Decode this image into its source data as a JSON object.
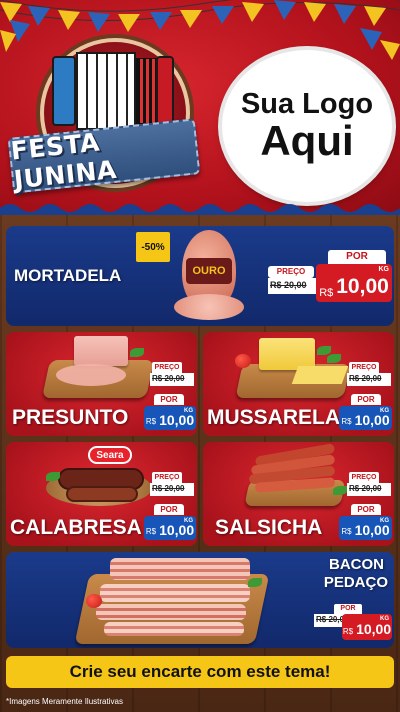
{
  "header": {
    "festival_title": "FESTA JUNINA",
    "logo_line1": "Sua Logo",
    "logo_line2": "Aqui"
  },
  "products": [
    {
      "name": "MORTADELA",
      "discount_badge": "-50%",
      "brand": "OURO",
      "old_price_label": "PREÇO",
      "old_price": "R$ 20,00",
      "new_price_label": "POR",
      "currency": "R$",
      "new_price": "10,00",
      "unit": "KG"
    },
    {
      "name": "PRESUNTO",
      "old_price_label": "PREÇO",
      "old_price": "R$ 20,00",
      "new_price_label": "POR",
      "currency": "R$",
      "new_price": "10,00",
      "unit": "KG"
    },
    {
      "name": "MUSSARELA",
      "old_price_label": "PREÇO",
      "old_price": "R$ 20,00",
      "new_price_label": "POR",
      "currency": "R$",
      "new_price": "10,00",
      "unit": "KG"
    },
    {
      "name": "CALABRESA",
      "brand": "Seara",
      "old_price_label": "PREÇO",
      "old_price": "R$ 20,00",
      "new_price_label": "POR",
      "currency": "R$",
      "new_price": "10,00",
      "unit": "KG"
    },
    {
      "name": "SALSICHA",
      "old_price_label": "PREÇO",
      "old_price": "R$ 20,00",
      "new_price_label": "POR",
      "currency": "R$",
      "new_price": "10,00",
      "unit": "KG"
    },
    {
      "name_line1": "BACON",
      "name_line2": "PEDAÇO",
      "old_price_label": "POR",
      "old_price": "R$ 20,00",
      "new_price_label": "POR",
      "currency": "R$",
      "new_price": "10,00",
      "unit": "KG"
    }
  ],
  "footer": {
    "cta": "Crie seu encarte com este tema!",
    "disclaimer": "*Imagens Meramente Ilustrativas"
  },
  "colors": {
    "header_red": "#c21e27",
    "card_blue": "#1a3a8a",
    "price_blue": "#1756b8",
    "price_red": "#d41b24",
    "footer_yellow": "#f5c616"
  }
}
